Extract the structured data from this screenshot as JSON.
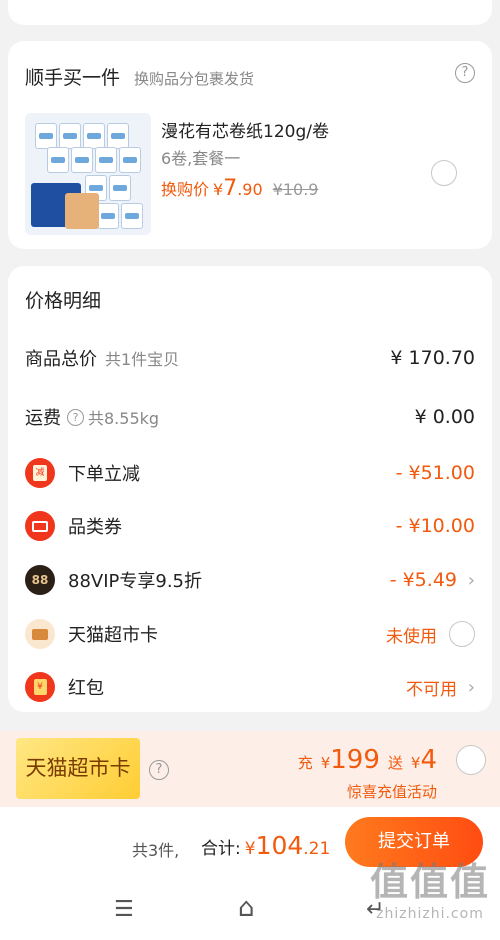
{
  "addon": {
    "title": "顺手买一件",
    "subtitle": "换购品分包裹发货",
    "help": "?",
    "product": {
      "name": "漫花有芯卷纸120g/卷",
      "spec": "6卷,套餐一",
      "price_label": "换购价",
      "currency": "¥",
      "price_int": "7",
      "price_dec": ".90",
      "old_price": "¥10.9"
    }
  },
  "detail": {
    "title": "价格明细",
    "rows": [
      {
        "label": "商品总价",
        "sub": "共1件宝贝",
        "value": "¥ 170.70"
      },
      {
        "label": "运费",
        "sub": "共8.55kg",
        "value": "¥ 0.00",
        "help": "?"
      },
      {
        "label": "下单立减",
        "value": "- ¥51.00",
        "icon": "jian-icon",
        "icon_text": "减"
      },
      {
        "label": "品类券",
        "value": "- ¥10.00",
        "icon": "ticket-icon"
      },
      {
        "label": "88VIP专享9.5折",
        "value": "- ¥5.49",
        "icon": "vip88-icon",
        "icon_text": "88",
        "chevron": "›"
      },
      {
        "label": "天猫超市卡",
        "value": "未使用",
        "icon": "card-icon"
      },
      {
        "label": "红包",
        "value": "不可用",
        "icon": "hongbao-icon",
        "icon_text": "¥",
        "chevron": "›"
      }
    ]
  },
  "promo": {
    "badge": "天猫超市卡",
    "help": "?",
    "prefix": "充",
    "currency": "¥",
    "charge": "199",
    "bonus_word": "送",
    "bonus": "4",
    "subtitle": "惊喜充值活动"
  },
  "footer": {
    "count": "共3件,",
    "total_label": "合计:",
    "currency": "¥",
    "total_int": "104",
    "total_dec": ".21",
    "submit": "提交订单"
  },
  "nav": {
    "menu": "☰",
    "home": "⌂",
    "back": "↵"
  },
  "watermark": {
    "title": "值值值",
    "site": "zhizhizhi.com"
  },
  "colors": {
    "accent": "#f25a0e",
    "red": "#f0361c",
    "background": "#f2f2f2"
  }
}
